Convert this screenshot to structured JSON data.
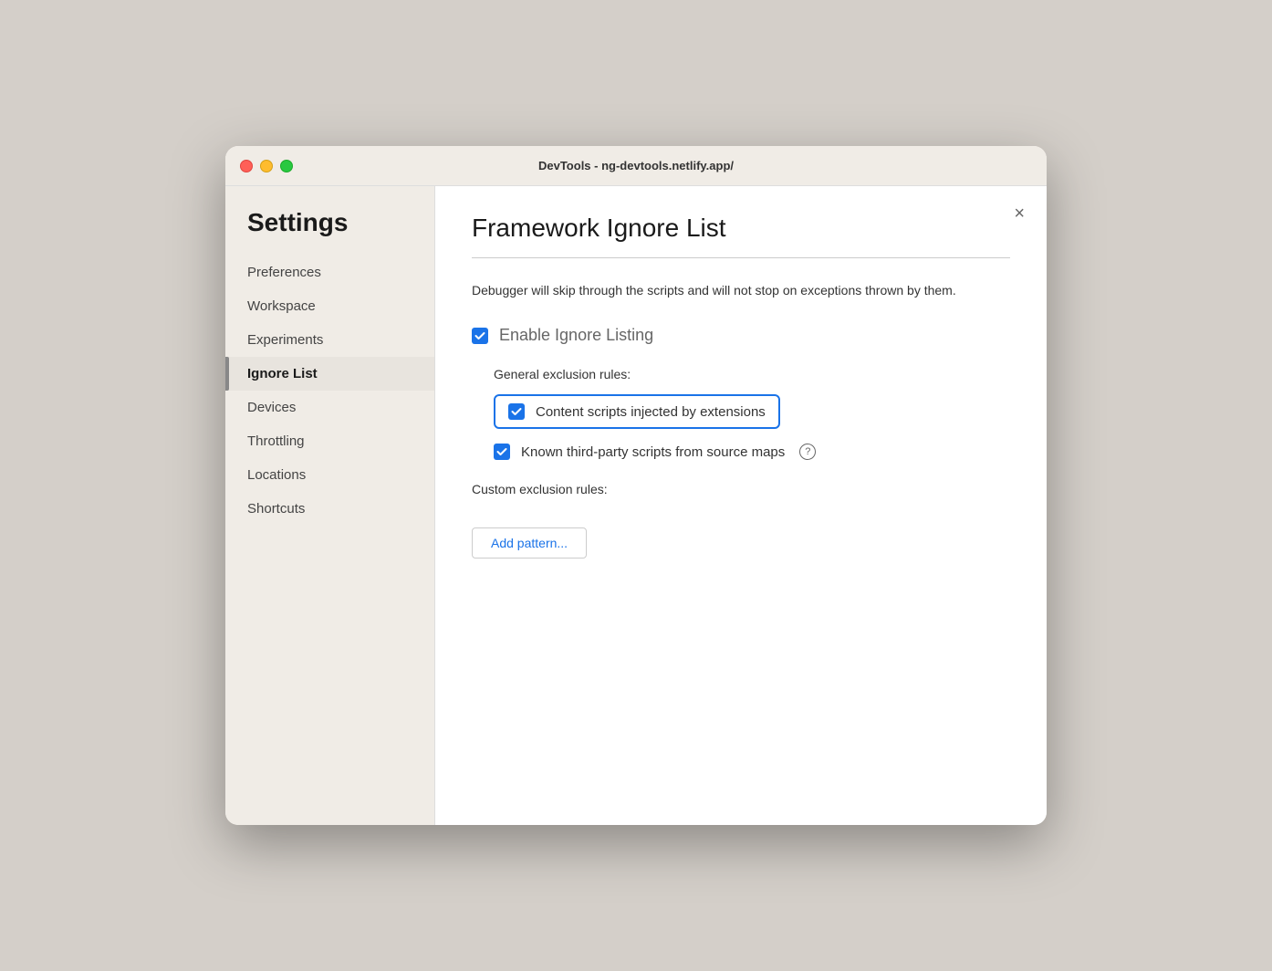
{
  "titlebar": {
    "title": "DevTools - ng-devtools.netlify.app/"
  },
  "sidebar": {
    "heading": "Settings",
    "items": [
      {
        "id": "preferences",
        "label": "Preferences",
        "active": false
      },
      {
        "id": "workspace",
        "label": "Workspace",
        "active": false
      },
      {
        "id": "experiments",
        "label": "Experiments",
        "active": false
      },
      {
        "id": "ignore-list",
        "label": "Ignore List",
        "active": true
      },
      {
        "id": "devices",
        "label": "Devices",
        "active": false
      },
      {
        "id": "throttling",
        "label": "Throttling",
        "active": false
      },
      {
        "id": "locations",
        "label": "Locations",
        "active": false
      },
      {
        "id": "shortcuts",
        "label": "Shortcuts",
        "active": false
      }
    ]
  },
  "main": {
    "close_label": "×",
    "title": "Framework Ignore List",
    "description": "Debugger will skip through the scripts and will not stop on exceptions thrown by them.",
    "enable_ignore_listing_label": "Enable Ignore Listing",
    "general_exclusion_label": "General exclusion rules:",
    "rule1_label": "Content scripts injected by extensions",
    "rule2_label": "Known third-party scripts from source maps",
    "custom_exclusion_label": "Custom exclusion rules:",
    "add_pattern_label": "Add pattern..."
  }
}
